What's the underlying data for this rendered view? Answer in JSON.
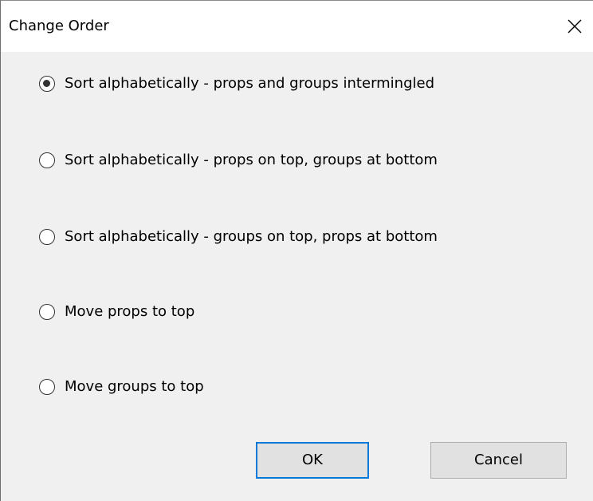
{
  "window": {
    "title": "Change Order",
    "close_icon": "close-x-icon"
  },
  "options": [
    {
      "label": "Sort alphabetically - props and groups intermingled",
      "checked": true
    },
    {
      "label": "Sort alphabetically - props on top, groups at bottom",
      "checked": false
    },
    {
      "label": "Sort alphabetically - groups on top, props at bottom",
      "checked": false
    },
    {
      "label": "Move props to top",
      "checked": false
    },
    {
      "label": "Move groups to top",
      "checked": false
    }
  ],
  "buttons": {
    "ok_label": "OK",
    "cancel_label": "Cancel"
  },
  "colors": {
    "dialog_background": "#f0f0f0",
    "titlebar_background": "#ffffff",
    "default_button_border": "#0078d7",
    "button_background": "#e1e1e1"
  }
}
